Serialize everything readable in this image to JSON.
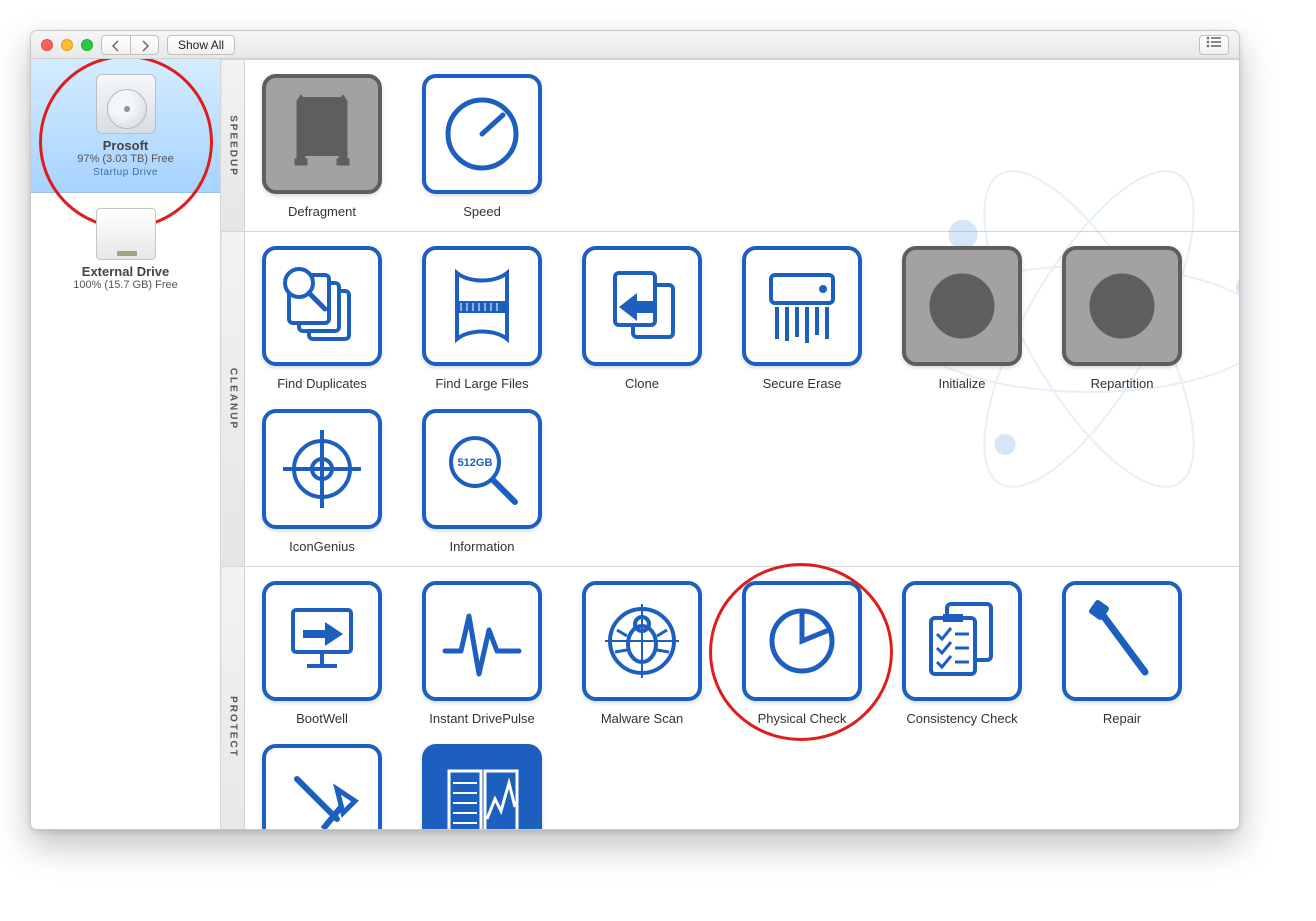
{
  "toolbar": {
    "show_all_label": "Show All"
  },
  "sidebar": {
    "drives": [
      {
        "name": "Prosoft",
        "sub": "97% (3.03 TB) Free",
        "badge": "Startup Drive",
        "selected": true,
        "highlighted": true
      },
      {
        "name": "External Drive",
        "sub": "100% (15.7 GB) Free",
        "badge": "",
        "selected": false,
        "highlighted": false
      }
    ]
  },
  "sections": [
    {
      "key": "speedup",
      "title": "SPEEDUP",
      "tools": [
        {
          "id": "defragment",
          "label": "Defragment",
          "disabled": true
        },
        {
          "id": "speed",
          "label": "Speed",
          "disabled": false
        }
      ]
    },
    {
      "key": "cleanup",
      "title": "CLEANUP",
      "tools": [
        {
          "id": "find-duplicates",
          "label": "Find Duplicates",
          "disabled": false
        },
        {
          "id": "find-large-files",
          "label": "Find Large Files",
          "disabled": false
        },
        {
          "id": "clone",
          "label": "Clone",
          "disabled": false
        },
        {
          "id": "secure-erase",
          "label": "Secure Erase",
          "disabled": false
        },
        {
          "id": "initialize",
          "label": "Initialize",
          "disabled": true
        },
        {
          "id": "repartition",
          "label": "Repartition",
          "disabled": true
        },
        {
          "id": "icongenius",
          "label": "IconGenius",
          "disabled": false
        },
        {
          "id": "information",
          "label": "Information",
          "disabled": false,
          "info_text": "512GB"
        }
      ]
    },
    {
      "key": "protect",
      "title": "PROTECT",
      "tools": [
        {
          "id": "bootwell",
          "label": "BootWell",
          "disabled": false
        },
        {
          "id": "instant-drivepulse",
          "label": "Instant DrivePulse",
          "disabled": false
        },
        {
          "id": "malware-scan",
          "label": "Malware Scan",
          "disabled": false
        },
        {
          "id": "physical-check",
          "label": "Physical Check",
          "disabled": false,
          "highlighted": true
        },
        {
          "id": "consistency-check",
          "label": "Consistency Check",
          "disabled": false
        },
        {
          "id": "repair",
          "label": "Repair",
          "disabled": false
        },
        {
          "id": "rebuild",
          "label": "",
          "disabled": false
        },
        {
          "id": "benchmark",
          "label": "",
          "disabled": false
        }
      ]
    }
  ]
}
